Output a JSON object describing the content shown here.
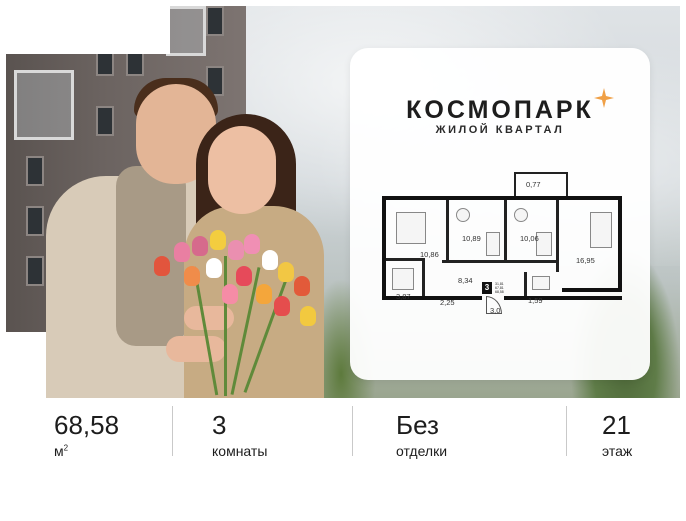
{
  "brand": {
    "name": "КОСМОПАРК",
    "subtitle": "ЖИЛОЙ КВАРТАЛ",
    "accent_color": "#f0a046",
    "star_icon": "star-icon"
  },
  "floorplan": {
    "rooms_count_badge": "3",
    "badge_lines": [
      "31,81",
      "67,81",
      "68,58"
    ],
    "room_areas": {
      "balcony": "0,77",
      "bedroom_left": "10,86",
      "bedroom_middle": "10,89",
      "bedroom_right": "10,06",
      "kitchen": "16,95",
      "bathroom": "3,87",
      "hall": "8,34",
      "corridor": "2,25",
      "entry": "3,0",
      "wc": "1,59"
    }
  },
  "stats": {
    "area": {
      "value": "68,58",
      "unit": "м",
      "sup": "2"
    },
    "rooms": {
      "value": "3",
      "unit": "комнаты"
    },
    "finish": {
      "value": "Без",
      "unit": "отделки"
    },
    "floor": {
      "value": "21",
      "unit": "этаж"
    }
  }
}
